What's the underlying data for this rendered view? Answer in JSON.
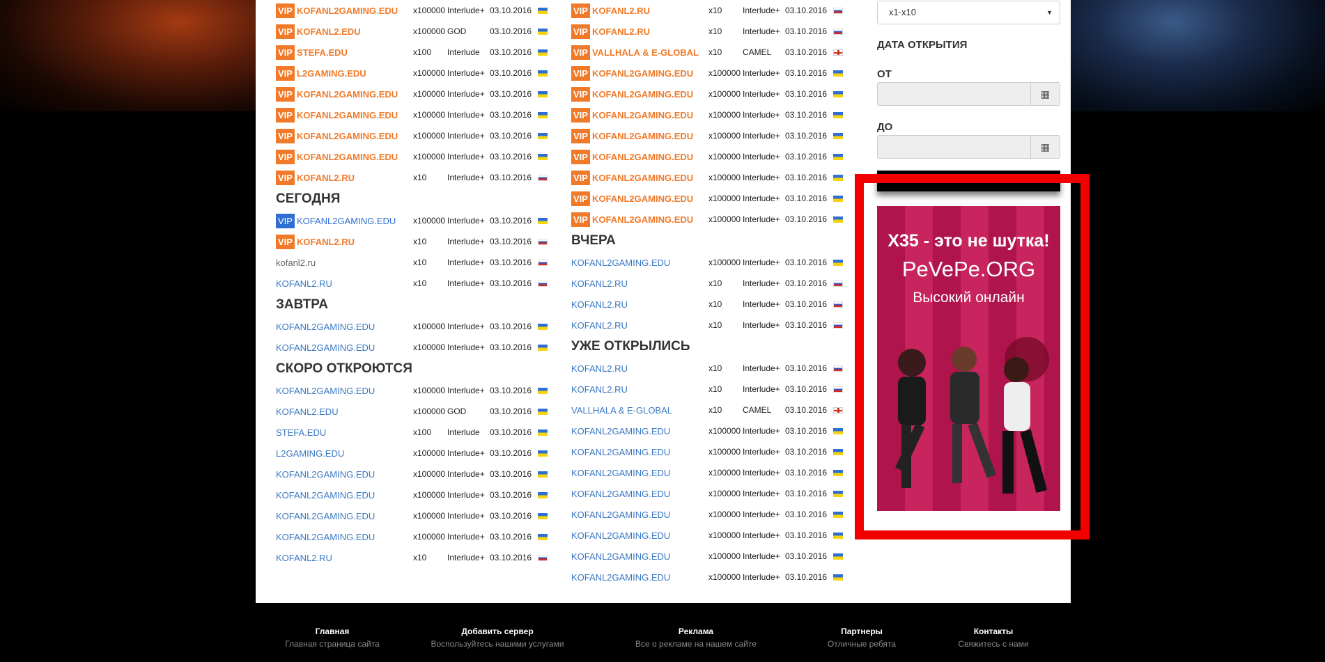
{
  "left_vip_top": [
    {
      "name": "KOFANL2GAMING.EDU",
      "rate": "x100000",
      "chron": "Interlude+",
      "date": "03.10.2016",
      "flag": "ua"
    },
    {
      "name": "KOFANL2.EDU",
      "rate": "x100000",
      "chron": "GOD",
      "date": "03.10.2016",
      "flag": "ua"
    },
    {
      "name": "STEFA.EDU",
      "rate": "x100",
      "chron": "Interlude",
      "date": "03.10.2016",
      "flag": "ua"
    },
    {
      "name": "L2GAMING.EDU",
      "rate": "x100000",
      "chron": "Interlude+",
      "date": "03.10.2016",
      "flag": "ua"
    },
    {
      "name": "KOFANL2GAMING.EDU",
      "rate": "x100000",
      "chron": "Interlude+",
      "date": "03.10.2016",
      "flag": "ua"
    },
    {
      "name": "KOFANL2GAMING.EDU",
      "rate": "x100000",
      "chron": "Interlude+",
      "date": "03.10.2016",
      "flag": "ua"
    },
    {
      "name": "KOFANL2GAMING.EDU",
      "rate": "x100000",
      "chron": "Interlude+",
      "date": "03.10.2016",
      "flag": "ua"
    },
    {
      "name": "KOFANL2GAMING.EDU",
      "rate": "x100000",
      "chron": "Interlude+",
      "date": "03.10.2016",
      "flag": "ua"
    },
    {
      "name": "KOFANL2.RU",
      "rate": "x10",
      "chron": "Interlude+",
      "date": "03.10.2016",
      "flag": "ru"
    }
  ],
  "sections": {
    "today": "СЕГОДНЯ",
    "tomorrow": "ЗАВТРА",
    "soon": "СКОРО ОТКРОЮТСЯ",
    "yesterday": "ВЧЕРА",
    "opened": "УЖЕ ОТКРЫЛИСЬ"
  },
  "vip_label": "VIP",
  "today_rows": [
    {
      "name": "KOFANL2GAMING.EDU",
      "style": "vip-blue",
      "rate": "x100000",
      "chron": "Interlude+",
      "date": "03.10.2016",
      "flag": "ua"
    },
    {
      "name": "KOFANL2.RU",
      "style": "vip-orange",
      "rate": "x10",
      "chron": "Interlude+",
      "date": "03.10.2016",
      "flag": "ru"
    },
    {
      "name": "kofanl2.ru",
      "style": "gray",
      "rate": "x10",
      "chron": "Interlude+",
      "date": "03.10.2016",
      "flag": "ru"
    },
    {
      "name": "KOFANL2.RU",
      "style": "link",
      "rate": "x10",
      "chron": "Interlude+",
      "date": "03.10.2016",
      "flag": "ru"
    }
  ],
  "tomorrow_rows": [
    {
      "name": "KOFANL2GAMING.EDU",
      "rate": "x100000",
      "chron": "Interlude+",
      "date": "03.10.2016",
      "flag": "ua"
    },
    {
      "name": "KOFANL2GAMING.EDU",
      "rate": "x100000",
      "chron": "Interlude+",
      "date": "03.10.2016",
      "flag": "ua"
    }
  ],
  "soon_rows": [
    {
      "name": "KOFANL2GAMING.EDU",
      "rate": "x100000",
      "chron": "Interlude+",
      "date": "03.10.2016",
      "flag": "ua"
    },
    {
      "name": "KOFANL2.EDU",
      "rate": "x100000",
      "chron": "GOD",
      "date": "03.10.2016",
      "flag": "ua"
    },
    {
      "name": "STEFA.EDU",
      "rate": "x100",
      "chron": "Interlude",
      "date": "03.10.2016",
      "flag": "ua"
    },
    {
      "name": "L2GAMING.EDU",
      "rate": "x100000",
      "chron": "Interlude+",
      "date": "03.10.2016",
      "flag": "ua"
    },
    {
      "name": "KOFANL2GAMING.EDU",
      "rate": "x100000",
      "chron": "Interlude+",
      "date": "03.10.2016",
      "flag": "ua"
    },
    {
      "name": "KOFANL2GAMING.EDU",
      "rate": "x100000",
      "chron": "Interlude+",
      "date": "03.10.2016",
      "flag": "ua"
    },
    {
      "name": "KOFANL2GAMING.EDU",
      "rate": "x100000",
      "chron": "Interlude+",
      "date": "03.10.2016",
      "flag": "ua"
    },
    {
      "name": "KOFANL2GAMING.EDU",
      "rate": "x100000",
      "chron": "Interlude+",
      "date": "03.10.2016",
      "flag": "ua"
    },
    {
      "name": "KOFANL2.RU",
      "rate": "x10",
      "chron": "Interlude+",
      "date": "03.10.2016",
      "flag": "ru"
    }
  ],
  "mid_vip_top": [
    {
      "name": "KOFANL2.RU",
      "rate": "x10",
      "chron": "Interlude+",
      "date": "03.10.2016",
      "flag": "ru"
    },
    {
      "name": "KOFANL2.RU",
      "rate": "x10",
      "chron": "Interlude+",
      "date": "03.10.2016",
      "flag": "ru"
    },
    {
      "name": "VALLHALA & E-GLOBAL",
      "rate": "x10",
      "chron": "CAMEL",
      "date": "03.10.2016",
      "flag": "gb"
    },
    {
      "name": "KOFANL2GAMING.EDU",
      "rate": "x100000",
      "chron": "Interlude+",
      "date": "03.10.2016",
      "flag": "ua"
    },
    {
      "name": "KOFANL2GAMING.EDU",
      "rate": "x100000",
      "chron": "Interlude+",
      "date": "03.10.2016",
      "flag": "ua"
    },
    {
      "name": "KOFANL2GAMING.EDU",
      "rate": "x100000",
      "chron": "Interlude+",
      "date": "03.10.2016",
      "flag": "ua"
    },
    {
      "name": "KOFANL2GAMING.EDU",
      "rate": "x100000",
      "chron": "Interlude+",
      "date": "03.10.2016",
      "flag": "ua"
    },
    {
      "name": "KOFANL2GAMING.EDU",
      "rate": "x100000",
      "chron": "Interlude+",
      "date": "03.10.2016",
      "flag": "ua"
    },
    {
      "name": "KOFANL2GAMING.EDU",
      "rate": "x100000",
      "chron": "Interlude+",
      "date": "03.10.2016",
      "flag": "ua"
    },
    {
      "name": "KOFANL2GAMING.EDU",
      "rate": "x100000",
      "chron": "Interlude+",
      "date": "03.10.2016",
      "flag": "ua"
    },
    {
      "name": "KOFANL2GAMING.EDU",
      "rate": "x100000",
      "chron": "Interlude+",
      "date": "03.10.2016",
      "flag": "ua"
    }
  ],
  "yesterday_rows": [
    {
      "name": "KOFANL2GAMING.EDU",
      "rate": "x100000",
      "chron": "Interlude+",
      "date": "03.10.2016",
      "flag": "ua"
    },
    {
      "name": "KOFANL2.RU",
      "rate": "x10",
      "chron": "Interlude+",
      "date": "03.10.2016",
      "flag": "ru"
    },
    {
      "name": "KOFANL2.RU",
      "rate": "x10",
      "chron": "Interlude+",
      "date": "03.10.2016",
      "flag": "ru"
    },
    {
      "name": "KOFANL2.RU",
      "rate": "x10",
      "chron": "Interlude+",
      "date": "03.10.2016",
      "flag": "ru"
    }
  ],
  "opened_rows": [
    {
      "name": "KOFANL2.RU",
      "rate": "x10",
      "chron": "Interlude+",
      "date": "03.10.2016",
      "flag": "ru"
    },
    {
      "name": "KOFANL2.RU",
      "rate": "x10",
      "chron": "Interlude+",
      "date": "03.10.2016",
      "flag": "ru"
    },
    {
      "name": "VALLHALA & E-GLOBAL",
      "rate": "x10",
      "chron": "CAMEL",
      "date": "03.10.2016",
      "flag": "gb"
    },
    {
      "name": "KOFANL2GAMING.EDU",
      "rate": "x100000",
      "chron": "Interlude+",
      "date": "03.10.2016",
      "flag": "ua"
    },
    {
      "name": "KOFANL2GAMING.EDU",
      "rate": "x100000",
      "chron": "Interlude+",
      "date": "03.10.2016",
      "flag": "ua"
    },
    {
      "name": "KOFANL2GAMING.EDU",
      "rate": "x100000",
      "chron": "Interlude+",
      "date": "03.10.2016",
      "flag": "ua"
    },
    {
      "name": "KOFANL2GAMING.EDU",
      "rate": "x100000",
      "chron": "Interlude+",
      "date": "03.10.2016",
      "flag": "ua"
    },
    {
      "name": "KOFANL2GAMING.EDU",
      "rate": "x100000",
      "chron": "Interlude+",
      "date": "03.10.2016",
      "flag": "ua"
    },
    {
      "name": "KOFANL2GAMING.EDU",
      "rate": "x100000",
      "chron": "Interlude+",
      "date": "03.10.2016",
      "flag": "ua"
    },
    {
      "name": "KOFANL2GAMING.EDU",
      "rate": "x100000",
      "chron": "Interlude+",
      "date": "03.10.2016",
      "flag": "ua"
    },
    {
      "name": "KOFANL2GAMING.EDU",
      "rate": "x100000",
      "chron": "Interlude+",
      "date": "03.10.2016",
      "flag": "ua"
    }
  ],
  "sidebar": {
    "rate_select": "x1-x10",
    "open_date_label": "ДАТА ОТКРЫТИЯ",
    "from_label": "ОТ",
    "to_label": "ДО",
    "calendar_icon": "calendar-icon"
  },
  "ad": {
    "line1": "X35 - это не шутка!",
    "line2": "PeVePe.ORG",
    "line3": "Высокий онлайн"
  },
  "footer": [
    {
      "title": "Главная",
      "sub": "Главная страница сайта"
    },
    {
      "title": "Добавить сервер",
      "sub": "Воспользуйтесь нашими услугами"
    },
    {
      "title": "Реклама",
      "sub": "Все о рекламе на нашем сайте"
    },
    {
      "title": "Партнеры",
      "sub": "Отличные ребята"
    },
    {
      "title": "Контакты",
      "sub": "Свяжитесь с нами"
    }
  ],
  "colors": {
    "vip_orange": "#f07a2a",
    "vip_blue": "#2f6fd3",
    "link": "#3a78c3",
    "highlight": "#f20000"
  }
}
